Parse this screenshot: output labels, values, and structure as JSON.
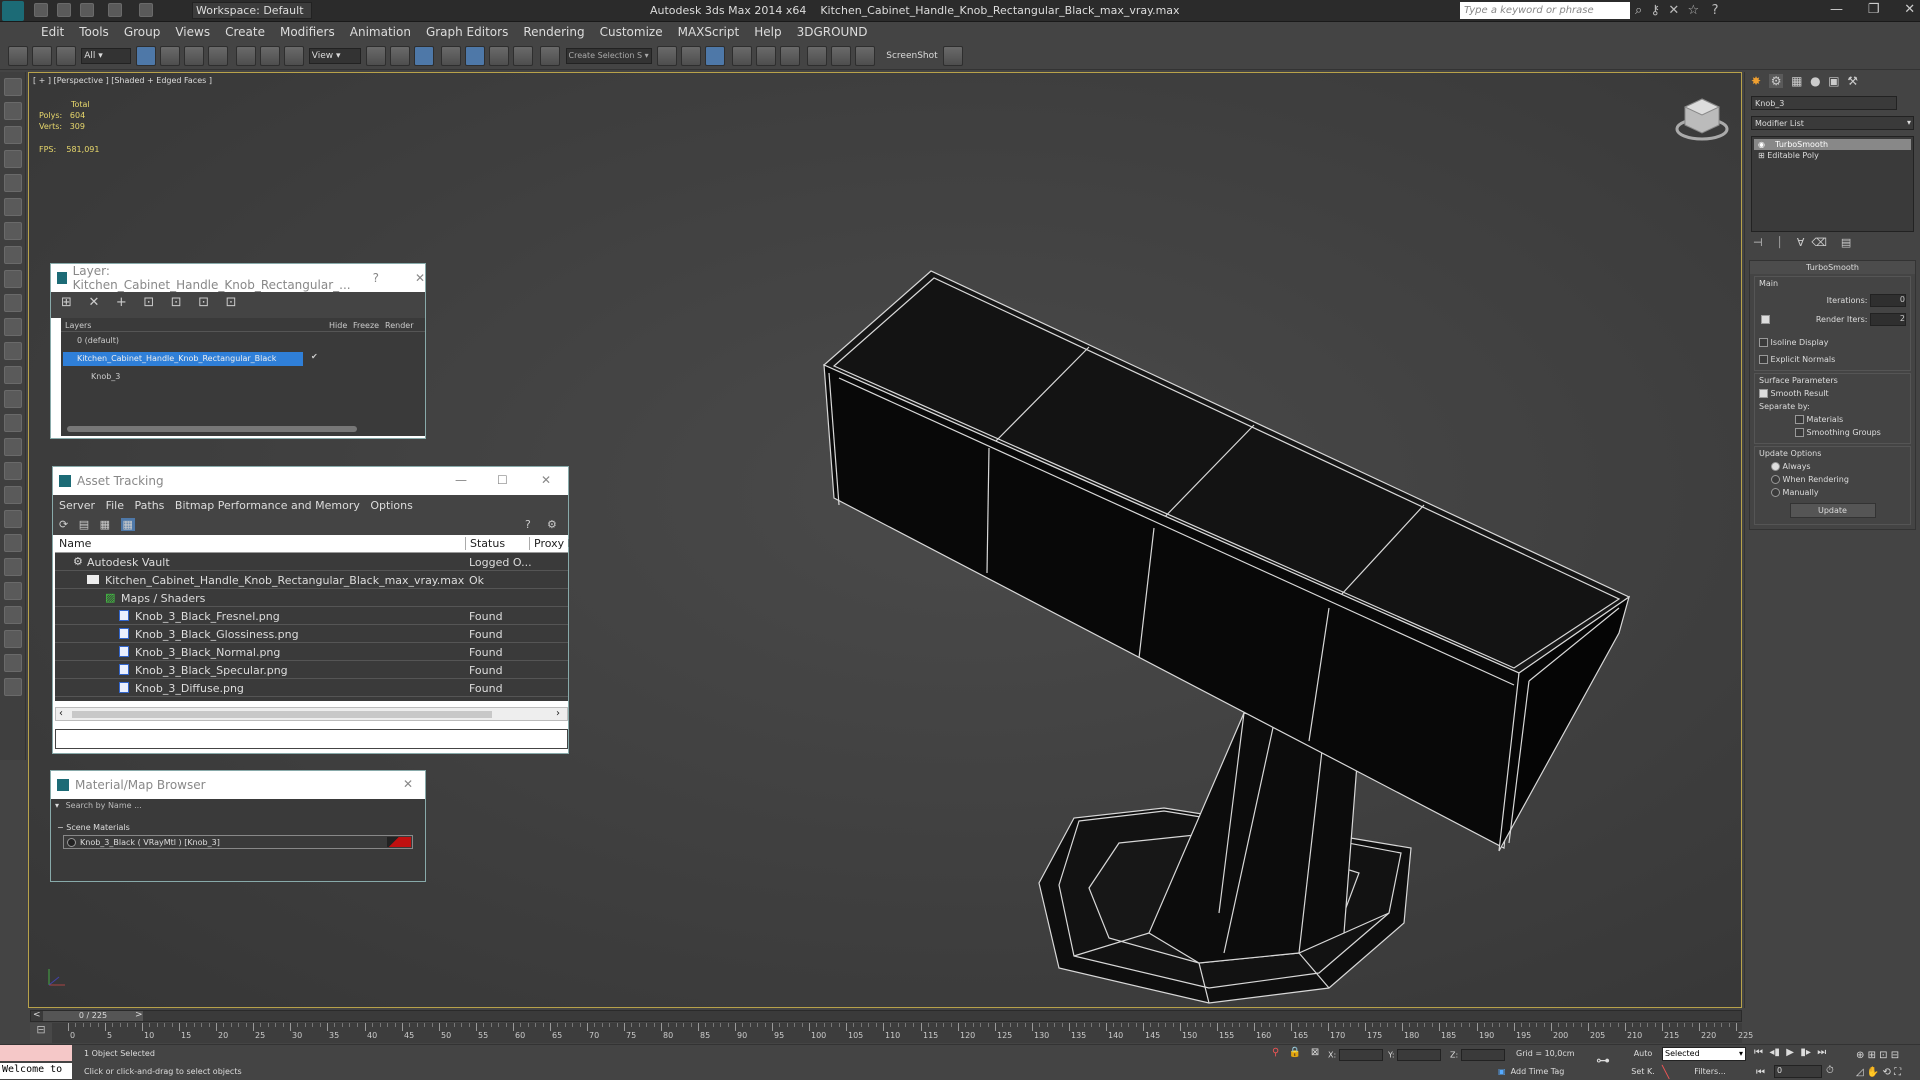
{
  "title_bar": {
    "workspace": "Workspace: Default",
    "app_title": "Autodesk 3ds Max  2014 x64",
    "file_title": "Kitchen_Cabinet_Handle_Knob_Rectangular_Black_max_vray.max",
    "search_placeholder": "Type a keyword or phrase"
  },
  "menu": [
    "Edit",
    "Tools",
    "Group",
    "Views",
    "Create",
    "Modifiers",
    "Animation",
    "Graph Editors",
    "Rendering",
    "Customize",
    "MAXScript",
    "Help",
    "3DGROUND"
  ],
  "toolbar": {
    "filter": "All",
    "ref_coord": "View",
    "named_sel": "Create Selection S",
    "screenshot": "ScreenShot"
  },
  "viewport": {
    "label": "[ + ] [Perspective ] [Shaded + Edged Faces ]",
    "stats": {
      "total": "Total",
      "polys_label": "Polys:",
      "polys": "604",
      "verts_label": "Verts:",
      "verts": "309",
      "fps_label": "FPS:",
      "fps": "581,091"
    }
  },
  "layer_window": {
    "title": "Layer: Kitchen_Cabinet_Handle_Knob_Rectangular_...",
    "help": "?",
    "cols": [
      "Layers",
      "Hide",
      "Freeze",
      "Render"
    ],
    "rows": [
      {
        "name": "0 (default)"
      },
      {
        "name": "Kitchen_Cabinet_Handle_Knob_Rectangular_Black"
      },
      {
        "name": "Knob_3"
      }
    ]
  },
  "asset_window": {
    "title": "Asset Tracking",
    "menu": [
      "Server",
      "File",
      "Paths",
      "Bitmap Performance and Memory",
      "Options"
    ],
    "cols": [
      "Name",
      "Status",
      "Proxy R"
    ],
    "rows": [
      {
        "name": "Autodesk Vault",
        "status": "Logged O..."
      },
      {
        "name": "Kitchen_Cabinet_Handle_Knob_Rectangular_Black_max_vray.max",
        "status": "Ok"
      },
      {
        "name": "Maps / Shaders",
        "status": ""
      },
      {
        "name": "Knob_3_Black_Fresnel.png",
        "status": "Found"
      },
      {
        "name": "Knob_3_Black_Glossiness.png",
        "status": "Found"
      },
      {
        "name": "Knob_3_Black_Normal.png",
        "status": "Found"
      },
      {
        "name": "Knob_3_Black_Specular.png",
        "status": "Found"
      },
      {
        "name": "Knob_3_Diffuse.png",
        "status": "Found"
      }
    ]
  },
  "material_browser": {
    "title": "Material/Map Browser",
    "search": "Search by Name ...",
    "section": "Scene Materials",
    "item": "Knob_3_Black  ( VRayMtl )  [Knob_3]"
  },
  "command_panel": {
    "object_name": "Knob_3",
    "modifier_list": "Modifier List",
    "stack": [
      "TurboSmooth",
      "Editable Poly"
    ],
    "rollout_title": "TurboSmooth",
    "main": "Main",
    "iterations_label": "Iterations:",
    "iterations": "0",
    "render_iters_label": "Render Iters:",
    "render_iters": "2",
    "isoline": "Isoline Display",
    "explicit": "Explicit Normals",
    "surface": "Surface Parameters",
    "smooth_result": "Smooth Result",
    "separate": "Separate by:",
    "materials": "Materials",
    "smoothing_groups": "Smoothing Groups",
    "update_options": "Update Options",
    "always": "Always",
    "when_rendering": "When Rendering",
    "manually": "Manually",
    "update": "Update"
  },
  "timeline": {
    "frame": "0 / 225",
    "ticks": [
      "0",
      "5",
      "10",
      "15",
      "20",
      "25",
      "30",
      "35",
      "40",
      "45",
      "50",
      "55",
      "60",
      "65",
      "70",
      "75",
      "80",
      "85",
      "90",
      "95",
      "100",
      "105",
      "110",
      "115",
      "120",
      "125",
      "130",
      "135",
      "140",
      "145",
      "150",
      "155",
      "160",
      "165",
      "170",
      "175",
      "180",
      "185",
      "190",
      "195",
      "200",
      "205",
      "210",
      "215",
      "220",
      "225"
    ]
  },
  "status": {
    "welcome": "Welcome to",
    "selected": "1 Object Selected",
    "prompt": "Click or click-and-drag to select objects",
    "x": "X:",
    "y": "Y:",
    "z": "Z:",
    "grid": "Grid = 10,0cm",
    "add_time_tag": "Add Time Tag",
    "auto": "Auto",
    "selected_dd": "Selected",
    "setk": "Set K.",
    "filters": "Filters...",
    "frame_field": "0"
  }
}
